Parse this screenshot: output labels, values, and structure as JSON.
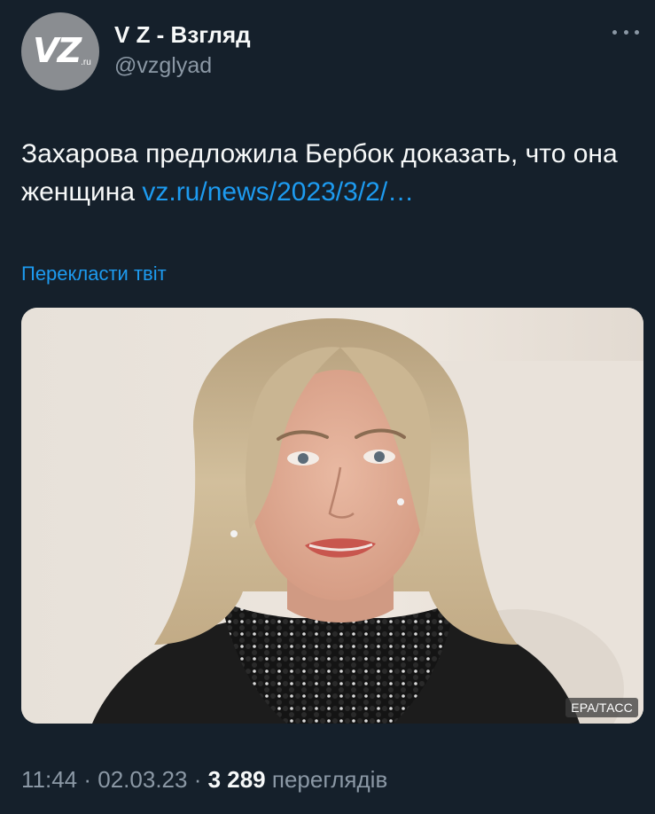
{
  "author": {
    "avatar_text": "VZ",
    "avatar_suffix": ".ru",
    "display_name": "V Z - Взгляд",
    "handle": "@vzglyad"
  },
  "more_icon": "more-horizontal-icon",
  "tweet": {
    "text": "Захарова предложила Бербок доказать, что она женщина ",
    "link": "vz.ru/news/2023/3/2/…",
    "translate_label": "Перекласти твіт",
    "media_credit": "EPA/ТАСС"
  },
  "meta": {
    "time": "11:44",
    "sep1": " · ",
    "date": "02.03.23",
    "sep2": " · ",
    "views": "3 289",
    "views_label": " переглядів"
  },
  "colors": {
    "background": "#15202b",
    "link": "#1d9bf0",
    "secondary_text": "#8b98a5",
    "primary_text": "#f7f9f9"
  }
}
